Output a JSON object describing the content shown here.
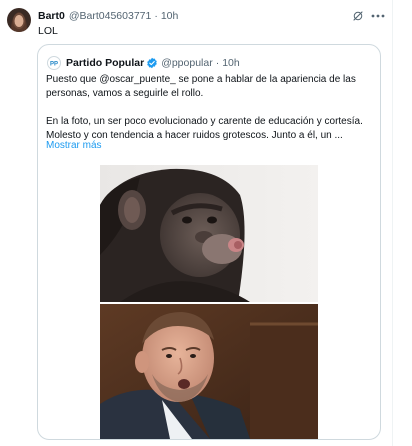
{
  "tweet": {
    "author_name": "Bart0",
    "author_handle": "@Bart045603771",
    "separator": "·",
    "time": "10h",
    "text": "LOL"
  },
  "quote": {
    "author_name": "Partido Popular",
    "author_handle": "@ppopular",
    "separator": "·",
    "time": "10h",
    "paragraph_1_line_1": "Puesto que @oscar_puente_ se pone a hablar de la apariencia de las",
    "paragraph_1_line_2": "personas, vamos a seguirle el rollo.",
    "paragraph_2_line_1": "En la foto, un ser poco evolucionado y carente de educación y cortesía.",
    "paragraph_2_line_2": "Molesto y con tendencia a hacer ruidos grotescos. Junto a él, un ...",
    "show_more": "Mostrar más"
  },
  "icons": {
    "grok": "grok-icon",
    "more": "more-horizontal-icon",
    "verified": "verified-badge-icon",
    "pp_logo": "pp-logo-icon"
  },
  "colors": {
    "link": "#1d9bf0",
    "secondary_text": "#536471",
    "primary_text": "#0f1419",
    "border": "#cfd9de",
    "verified": "#1d9bf0"
  }
}
